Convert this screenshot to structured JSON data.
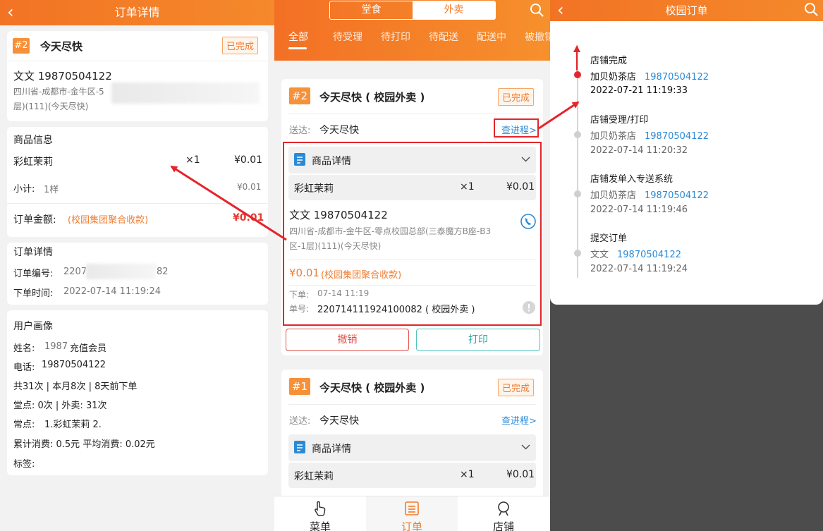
{
  "colors": {
    "accent": "#f37a27",
    "annotation_red": "#e4252b",
    "link_blue": "#2b8ad6",
    "done_badge": "#ef7e33"
  },
  "panel_a": {
    "title": "订单详情",
    "order": {
      "number": "#2",
      "name": "今天尽快",
      "status": "已完成"
    },
    "customer": {
      "name_phone": "文文 19870504122",
      "address_line1": "四川省-成都市-金牛区-5",
      "address_line2": "层)(111)(今天尽快)"
    },
    "goods": {
      "heading": "商品信息",
      "item_name": "彩虹茉莉",
      "item_qty": "×1",
      "item_price": "¥0.01",
      "subtotal_label": "小计:",
      "subtotal_count": "1样",
      "subtotal_value": "¥0.01",
      "amount_label": "订单金额:",
      "amount_note": "(校园集团聚合收款)",
      "amount_value": "¥0.01"
    },
    "order_detail": {
      "heading": "订单详情",
      "number_label": "订单编号:",
      "number_prefix": "2207",
      "number_suffix": "82",
      "time_label": "下单时间:",
      "time_value": "2022-07-14 11:19:24"
    },
    "profile": {
      "heading": "用户画像",
      "name_label": "姓名:",
      "name_num": "1987",
      "name_value": "充值会员",
      "phone_label": "电话:",
      "phone_value": "19870504122",
      "stats": "共31次 | 本月8次 | 8天前下单",
      "dine": "堂点: 0次 | 外卖: 31次",
      "frequent_label": "常点:",
      "frequent_value": "1.彩虹茉莉 2.",
      "spend": "累计消费: 0.5元 平均消费: 0.02元",
      "tags_label": "标签:"
    }
  },
  "panel_b": {
    "segment": {
      "dine_in": "堂食",
      "takeout": "外卖"
    },
    "tabs": [
      "全部",
      "待受理",
      "待打印",
      "待配送",
      "配送中",
      "被撤销"
    ],
    "order1": {
      "number": "#2",
      "title": "今天尽快 ( 校园外卖 )",
      "status": "已完成",
      "deliver_label": "送达:",
      "deliver_value": "今天尽快",
      "progress_link": "查进程>",
      "details_label": "商品详情",
      "item_name": "彩虹茉莉",
      "item_qty": "×1",
      "item_price": "¥0.01",
      "customer": "文文 19870504122",
      "address_line1": "四川省-成都市-金牛区-零点校园总部(三泰魔方B座-B3",
      "address_line2": "区-1层)(111)(今天尽快)",
      "price": "¥0.01",
      "price_note": "(校园集团聚合收款)",
      "order_time_label": "下单:",
      "order_time": "07-14 11:19",
      "order_no_label": "单号:",
      "order_no": "220714111924100082 ( 校园外卖 )",
      "cancel_btn": "撤销",
      "print_btn": "打印"
    },
    "order2": {
      "number": "#1",
      "title": "今天尽快 ( 校园外卖 )",
      "status": "已完成",
      "deliver_label": "送达:",
      "deliver_value": "今天尽快",
      "progress_link": "查进程>",
      "details_label": "商品详情",
      "item_name": "彩虹茉莉",
      "item_qty": "×1",
      "item_price": "¥0.01"
    },
    "nav": {
      "menu": "菜单",
      "orders": "订单",
      "shop": "店铺"
    }
  },
  "panel_c": {
    "title": "校园订单",
    "timeline": [
      {
        "title": "店铺完成",
        "actor": "加贝奶茶店",
        "phone": "19870504122",
        "time": "2022-07-21 11:19:33"
      },
      {
        "title": "店铺受理/打印",
        "actor": "加贝奶茶店",
        "phone": "19870504122",
        "time": "2022-07-14 11:20:32"
      },
      {
        "title": "店铺发单入专送系统",
        "actor": "加贝奶茶店",
        "phone": "19870504122",
        "time": "2022-07-14 11:19:46"
      },
      {
        "title": "提交订单",
        "actor": "文文",
        "phone": "19870504122",
        "time": "2022-07-14 11:19:24"
      }
    ]
  }
}
